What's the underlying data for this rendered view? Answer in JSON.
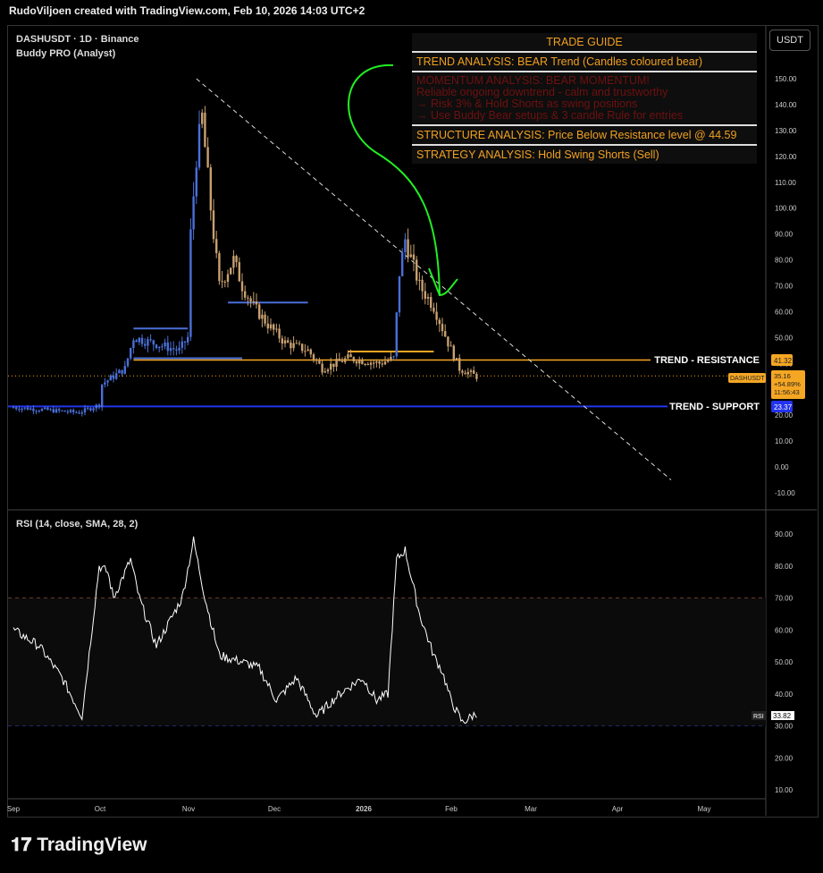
{
  "header": {
    "credit": "RudoViljoen created with TradingView.com, Feb 10, 2026 14:03 UTC+2"
  },
  "legend": {
    "symbol": "DASHUSDT · 1D · Binance",
    "indicator": "Buddy PRO (Analyst)",
    "rsi": "RSI (14, close, SMA, 28, 2)"
  },
  "currency_button": "USDT",
  "trade_guide": {
    "title": "TRADE GUIDE",
    "trend": "TREND ANALYSIS: BEAR Trend (Candles coloured bear)",
    "momentum": [
      "MOMENTUM ANALYSIS: BEAR MOMENTUM!",
      " Reliable ongoing downtrend - calm and trustworthy",
      "→ Risk 3% & Hold Shorts as swing positions",
      "→ Use Buddy Bear setups & 3 candle Rule for entries"
    ],
    "structure": "STRUCTURE ANALYSIS: Price Below Resistance level @ 44.59",
    "strategy": "STRATEGY ANALYSIS: Hold Swing Shorts (Sell)"
  },
  "labels": {
    "resistance": "TREND - RESISTANCE",
    "support": "TREND - SUPPORT",
    "resistance_price": "41.32",
    "support_price": "23.37",
    "symbol_tag": "DASHUSDT",
    "last_price": "35.16",
    "change": "+54.89%",
    "countdown": "11:56:43",
    "rsi_tag": "RSI",
    "rsi_value": "33.82"
  },
  "brand": "TradingView",
  "colors": {
    "bull": "#4a6fd8",
    "bear": "#c8a070",
    "resistance": "#f5a623",
    "support": "#2233ee",
    "rsi": "#ffffff"
  },
  "chart_data": {
    "type": "candlestick",
    "price_axis": [
      "150.00",
      "140.00",
      "130.00",
      "120.00",
      "110.00",
      "100.00",
      "90.00",
      "80.00",
      "70.00",
      "60.00",
      "50.00",
      "40.00",
      "30.00",
      "20.00",
      "10.00",
      "0.00",
      "-10.00"
    ],
    "rsi_axis": [
      "90.00",
      "80.00",
      "70.00",
      "60.00",
      "50.00",
      "40.00",
      "30.00",
      "20.00",
      "10.00"
    ],
    "time_axis": [
      "Sep",
      "Oct",
      "Nov",
      "Dec",
      "2026",
      "Feb",
      "Mar",
      "Apr",
      "May"
    ],
    "price_path_day": [
      0,
      23,
      30,
      31,
      39,
      42,
      58,
      61,
      62,
      64,
      66,
      69,
      72,
      77,
      80,
      84,
      89,
      95,
      103,
      108,
      117,
      128,
      133,
      135,
      137,
      142,
      147,
      152,
      156,
      162
    ],
    "price_path_close": [
      23,
      21,
      24,
      32,
      38,
      50,
      45,
      50,
      90,
      120,
      135,
      100,
      70,
      80,
      70,
      62,
      55,
      48,
      45,
      38,
      42,
      40,
      42,
      75,
      88,
      70,
      62,
      48,
      38,
      35
    ],
    "rsi_day": [
      0,
      9,
      17,
      24,
      30,
      33,
      35,
      41,
      44,
      50,
      59,
      63,
      67,
      72,
      80,
      86,
      92,
      99,
      106,
      114,
      122,
      127,
      131,
      134,
      137,
      142,
      147,
      150,
      153,
      157,
      162
    ],
    "rsi_value": [
      60,
      55,
      45,
      33,
      80,
      78,
      70,
      82,
      70,
      55,
      70,
      88,
      70,
      52,
      50,
      48,
      38,
      45,
      33,
      40,
      45,
      38,
      40,
      82,
      85,
      65,
      52,
      47,
      38,
      31,
      34
    ],
    "rsi_levels": [
      70,
      50,
      30
    ],
    "resistance": 41.32,
    "support": 23.37,
    "trendline": [
      [
        64,
        150
      ],
      [
        230,
        -5
      ]
    ]
  }
}
